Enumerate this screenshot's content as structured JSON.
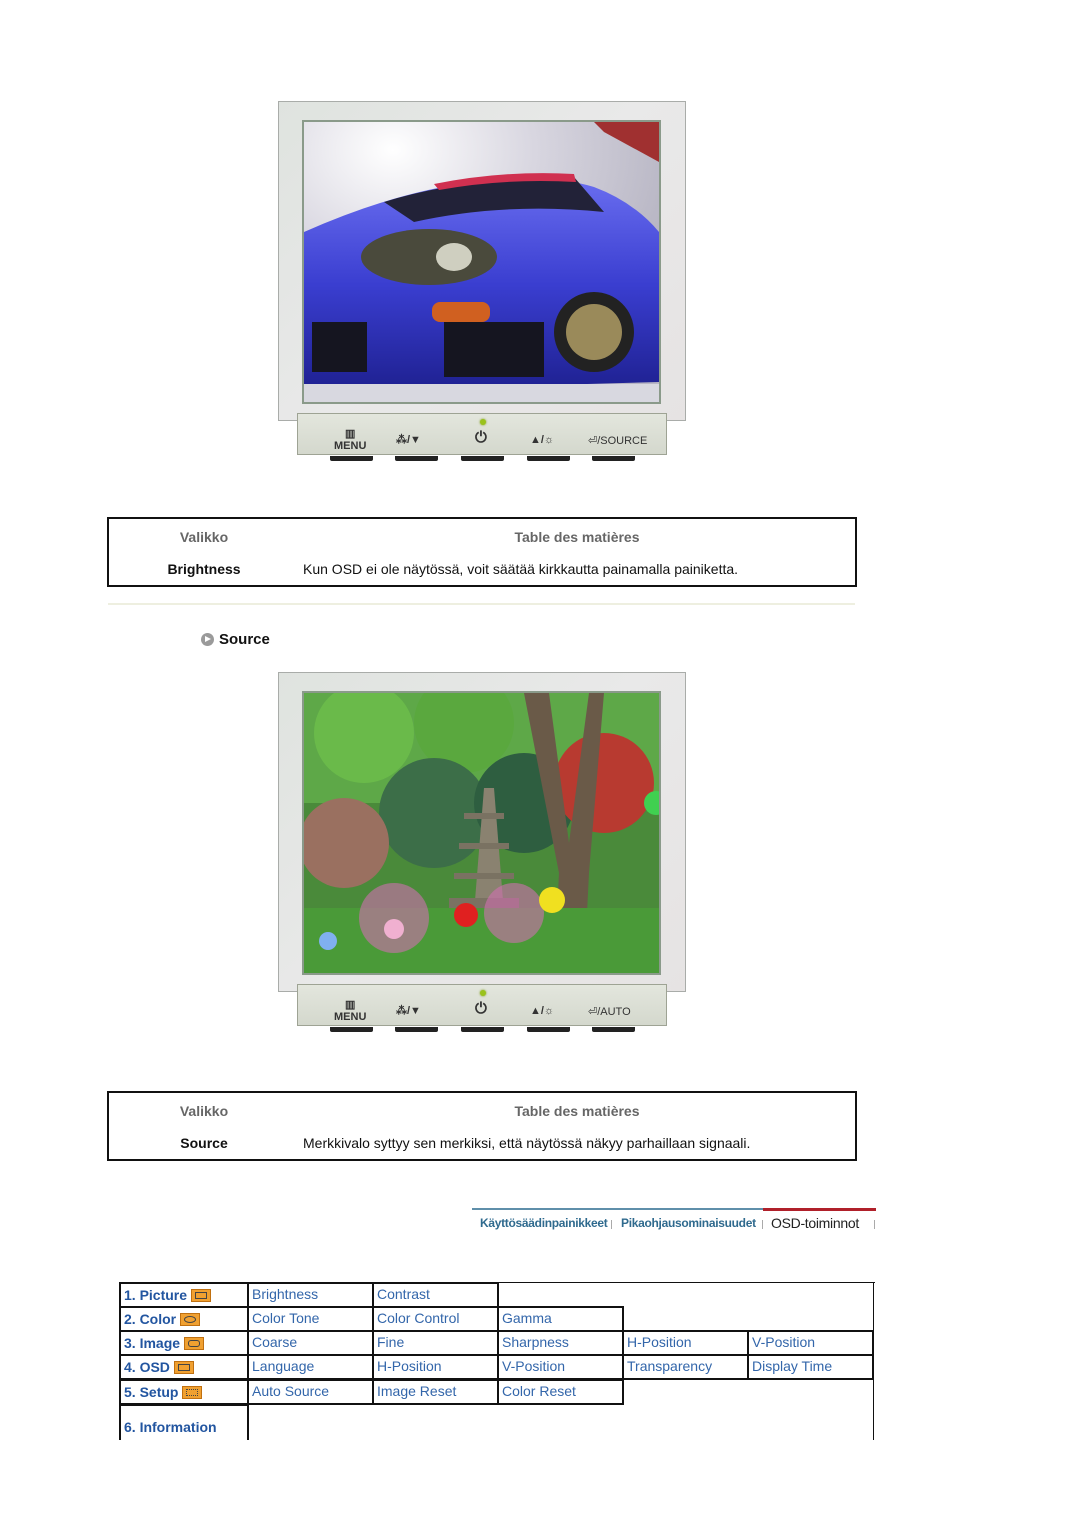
{
  "monitor1": {
    "image_alt": "blue sports car photo on monitor screen",
    "buttons": [
      "MENU",
      "▲▼ / ▼",
      "power",
      "▲ / ☼",
      "⏎ / SOURCE"
    ],
    "menu_label": "MENU",
    "source_label": "SOURCE"
  },
  "table1": {
    "header_col1": "Valikko",
    "header_col2": "Table des matières",
    "item": "Brightness",
    "description": "Kun OSD ei ole näytössä, voit säätää kirkkautta painamalla painiketta."
  },
  "section": {
    "title": "Source"
  },
  "monitor2": {
    "image_alt": "garden with pagoda and lanterns on monitor screen",
    "menu_label": "MENU",
    "auto_label": "AUTO"
  },
  "table2": {
    "header_col1": "Valikko",
    "header_col2": "Table des matières",
    "item": "Source",
    "description": "Merkkivalo syttyy sen merkiksi, että näytössä näkyy parhaillaan signaali."
  },
  "nav": {
    "tabs": [
      {
        "label": "Käyttösäädinpainikkeet",
        "active": false
      },
      {
        "label": "Pikaohjausominaisuudet",
        "active": false
      },
      {
        "label": "OSD-toiminnot",
        "active": true
      }
    ],
    "colors": {
      "inactive_line": "#5f8faa",
      "active_line": "#b0202a"
    }
  },
  "osd_menu": {
    "rows": [
      {
        "label": "1. Picture",
        "icon": "picture-icon",
        "items": [
          "Brightness",
          "Contrast"
        ]
      },
      {
        "label": "2. Color",
        "icon": "color-icon",
        "items": [
          "Color Tone",
          "Color Control",
          "Gamma"
        ]
      },
      {
        "label": "3. Image",
        "icon": "image-icon",
        "items": [
          "Coarse",
          "Fine",
          "Sharpness",
          "H-Position",
          "V-Position"
        ]
      },
      {
        "label": "4. OSD",
        "icon": "osd-icon",
        "items": [
          "Language",
          "H-Position",
          "V-Position",
          "Transparency",
          "Display Time"
        ]
      },
      {
        "label": "5. Setup",
        "icon": "setup-icon",
        "items": [
          "Auto Source",
          "Image Reset",
          "Color Reset"
        ]
      },
      {
        "label": "6. Information",
        "icon": "",
        "items": []
      }
    ]
  }
}
